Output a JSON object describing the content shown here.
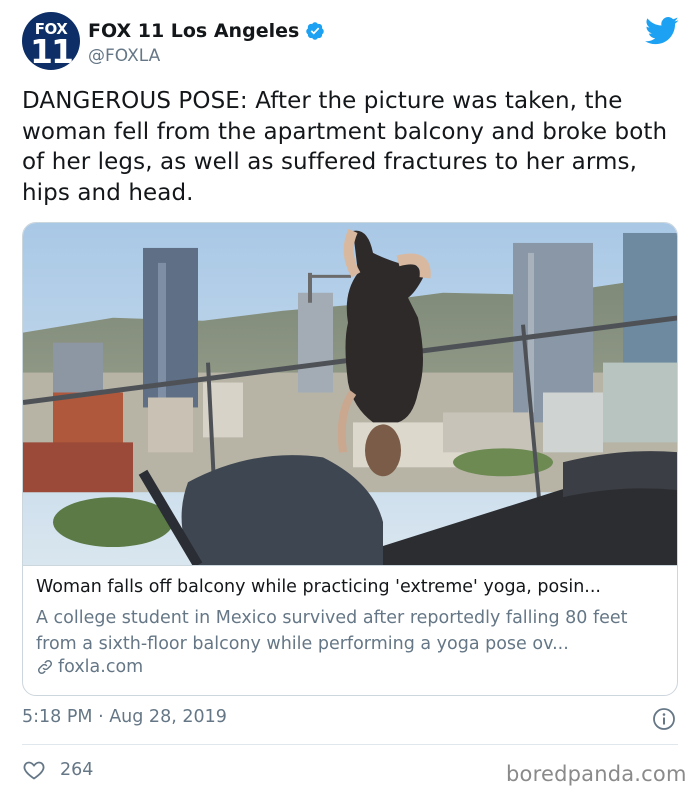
{
  "account": {
    "avatar_top": "FOX",
    "avatar_bottom": "11",
    "display_name": "FOX 11 Los Angeles",
    "handle": "@FOXLA",
    "verified": true
  },
  "tweet": {
    "text": "DANGEROUS POSE: After the picture was taken, the woman fell from the apartment balcony and broke both of her legs, as well as suffered fractures to her arms, hips and head."
  },
  "card": {
    "image_icon": "photo-woman-hanging-upside-down-from-balcony",
    "title": "Woman falls off balcony while practicing 'extreme' yoga, posin...",
    "description": "A college student in Mexico survived after reportedly falling 80 feet from a sixth-floor balcony while performing a yoga pose ov...",
    "domain": "foxla.com"
  },
  "meta": {
    "timestamp": "5:18 PM · Aug 28, 2019",
    "likes": "264"
  },
  "watermark": "boredpanda.com",
  "colors": {
    "twitter_blue": "#1da1f2",
    "secondary_text": "#657786",
    "border": "#ccd6dd",
    "fox_navy": "#0d2e66"
  }
}
